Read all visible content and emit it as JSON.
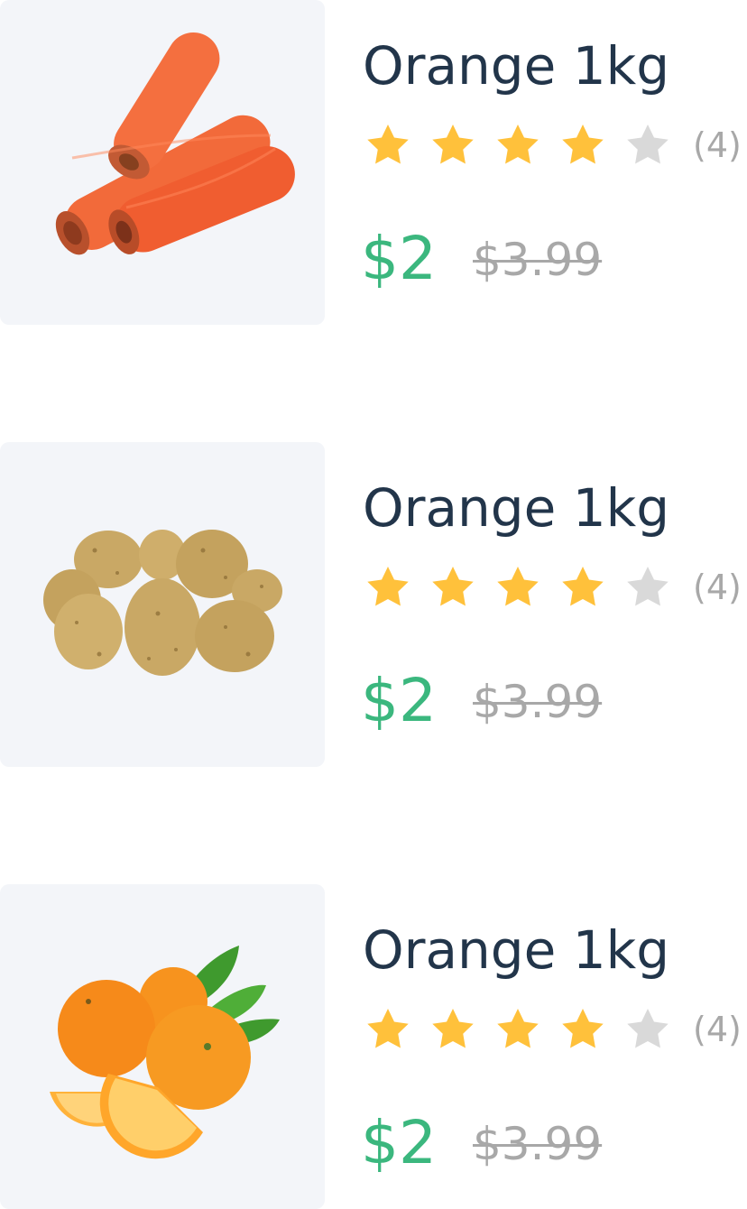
{
  "colors": {
    "title": "#22354a",
    "price": "#3bb77e",
    "muted": "#a8a8a8",
    "star_filled": "#ffc13b",
    "star_empty": "#d9d9d9",
    "card_bg": "#f3f5f9"
  },
  "products": [
    {
      "name": "Orange 1kg",
      "image": "carrots",
      "rating": 4,
      "rating_max": 5,
      "rating_count": "(4)",
      "price": "$2",
      "old_price": "$3.99"
    },
    {
      "name": "Orange 1kg",
      "image": "potatoes",
      "rating": 4,
      "rating_max": 5,
      "rating_count": "(4)",
      "price": "$2",
      "old_price": "$3.99"
    },
    {
      "name": "Orange 1kg",
      "image": "oranges",
      "rating": 4,
      "rating_max": 5,
      "rating_count": "(4)",
      "price": "$2",
      "old_price": "$3.99"
    }
  ]
}
